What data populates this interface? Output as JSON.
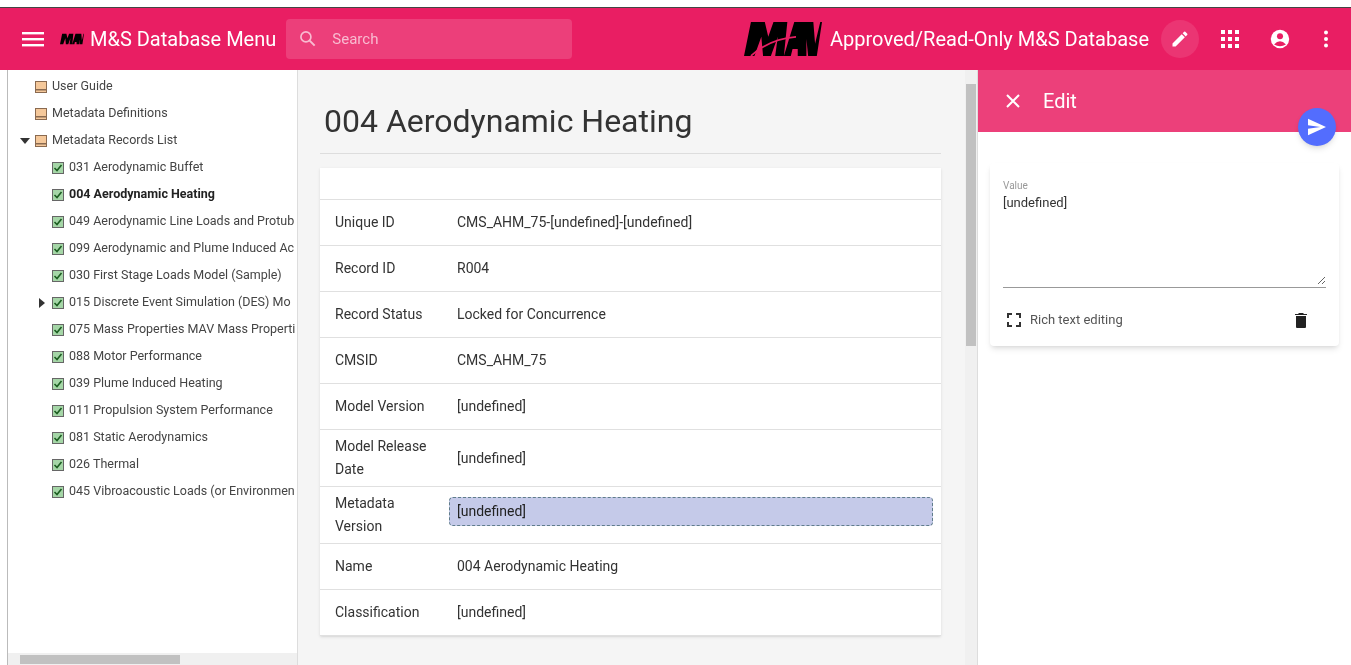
{
  "app_bar": {
    "menu_title": "M&S Database Menu",
    "search": {
      "placeholder": "Search"
    },
    "title": "Approved/Read-Only M&S Database"
  },
  "sidebar": {
    "items": [
      {
        "kind": "folder",
        "label": "User Guide",
        "selected": false
      },
      {
        "kind": "folder",
        "label": "Metadata Definitions",
        "selected": false
      },
      {
        "kind": "folder",
        "label": "Metadata Records List",
        "selected": false,
        "expanded": true,
        "children": [
          {
            "kind": "record",
            "label": "031 Aerodynamic Buffet",
            "checked": true,
            "selected": false
          },
          {
            "kind": "record",
            "label": "004 Aerodynamic Heating",
            "checked": true,
            "selected": true
          },
          {
            "kind": "record",
            "label": "049 Aerodynamic Line Loads and Protub",
            "checked": true,
            "selected": false
          },
          {
            "kind": "record",
            "label": "099 Aerodynamic and Plume Induced Ac",
            "checked": true,
            "selected": false
          },
          {
            "kind": "record",
            "label": "030 First Stage Loads Model (Sample)",
            "checked": true,
            "selected": false
          },
          {
            "kind": "record",
            "label": "015 Discrete Event Simulation (DES) Mo",
            "checked": true,
            "selected": false,
            "expanded": false
          },
          {
            "kind": "record",
            "label": "075 Mass Properties MAV Mass Properti",
            "checked": true,
            "selected": false
          },
          {
            "kind": "record",
            "label": "088 Motor Performance",
            "checked": true,
            "selected": false
          },
          {
            "kind": "record",
            "label": "039 Plume Induced Heating",
            "checked": true,
            "selected": false
          },
          {
            "kind": "record",
            "label": "011 Propulsion System Performance",
            "checked": true,
            "selected": false
          },
          {
            "kind": "record",
            "label": "081 Static Aerodynamics",
            "checked": true,
            "selected": false
          },
          {
            "kind": "record",
            "label": "026 Thermal",
            "checked": true,
            "selected": false
          },
          {
            "kind": "record",
            "label": "045 Vibroacoustic Loads (or Environmen",
            "checked": true,
            "selected": false
          }
        ]
      }
    ]
  },
  "record": {
    "title": "004 Aerodynamic Heating",
    "fields": [
      {
        "label": "Unique ID",
        "value": "CMS_AHM_75-[undefined]-[undefined]",
        "selected": false
      },
      {
        "label": "Record ID",
        "value": "R004",
        "selected": false
      },
      {
        "label": "Record Status",
        "value": "Locked for Concurrence",
        "selected": false
      },
      {
        "label": "CMSID",
        "value": "CMS_AHM_75",
        "selected": false
      },
      {
        "label": "Model Version",
        "value": "[undefined]",
        "selected": false
      },
      {
        "label": "Model Release Date",
        "value": "[undefined]",
        "selected": false
      },
      {
        "label": "Metadata Version",
        "value": "[undefined]",
        "selected": true
      },
      {
        "label": "Name",
        "value": "004 Aerodynamic Heating",
        "selected": false
      },
      {
        "label": "Classification",
        "value": "[undefined]",
        "selected": false
      }
    ]
  },
  "edit_panel": {
    "title": "Edit",
    "field_label": "Value",
    "field_value": "[undefined]",
    "rich_text_label": "Rich text editing"
  }
}
